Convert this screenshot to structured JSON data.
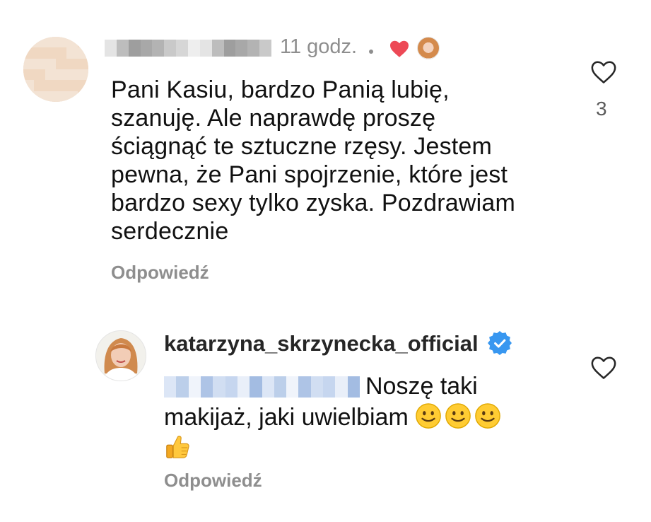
{
  "comments": [
    {
      "username_redacted": true,
      "time": "11 godz.",
      "liked_by_author": true,
      "text_lines": [
        "Pani Kasiu, bardzo Panią lubię,",
        "szanuję. Ale naprawdę proszę",
        "ściągnąć te sztuczne rzęsy. Jestem",
        "pewna, że Pani spojrzenie, które jest",
        "bardzo sexy tylko zyska. Pozdrawiam",
        "serdecznie"
      ],
      "reply_label": "Odpowiedź",
      "like_count": "3",
      "icons": {
        "like": "heart-outline-icon",
        "author_like": "heart-filled-icon"
      },
      "colors": {
        "heart": "#ed4956",
        "muted": "#8e8e8e"
      }
    },
    {
      "username": "katarzyna_skrzynecka_official",
      "verified": true,
      "mention_redacted": true,
      "text_line1": "Noszę taki",
      "text_line2": "makijaż, jaki uwielbiam",
      "emojis": [
        "slightly-smiling-face",
        "slightly-smiling-face",
        "slightly-smiling-face",
        "thumbs-up"
      ],
      "reply_label": "Odpowiedź",
      "icons": {
        "like": "heart-outline-icon",
        "verified": "verified-badge-icon"
      },
      "colors": {
        "verified": "#3897f0"
      }
    }
  ]
}
